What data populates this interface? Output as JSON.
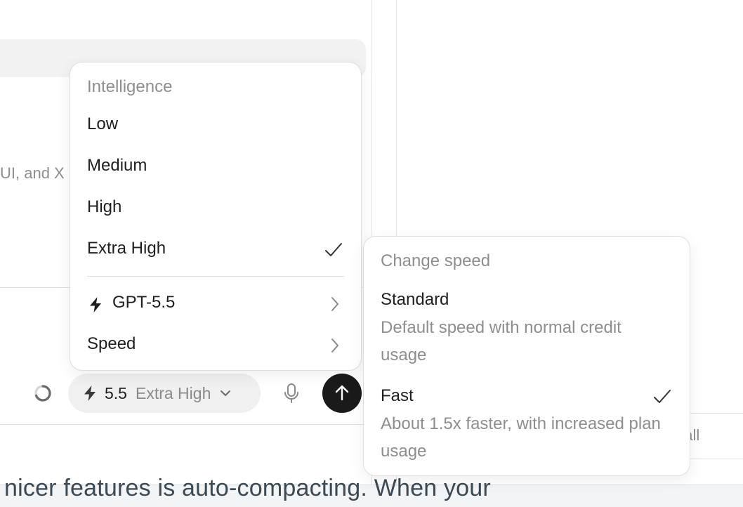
{
  "background": {
    "partial_text": "UI, and X",
    "right_card_text": "t all",
    "article_text": "nicer features is auto-compacting. When your"
  },
  "composer": {
    "model_version": "5.5",
    "model_effort": "Extra High",
    "icons": {
      "spinner": "spinner-icon",
      "bolt": "bolt-icon",
      "chevron": "chevron-down-icon",
      "mic": "mic-icon",
      "send": "arrow-up-icon"
    }
  },
  "intelligence_menu": {
    "heading": "Intelligence",
    "options": [
      {
        "label": "Low",
        "selected": false
      },
      {
        "label": "Medium",
        "selected": false
      },
      {
        "label": "High",
        "selected": false
      },
      {
        "label": "Extra High",
        "selected": true
      }
    ],
    "submenus": [
      {
        "label": "GPT-5.5",
        "icon": "bolt-icon"
      },
      {
        "label": "Speed"
      }
    ]
  },
  "speed_menu": {
    "heading": "Change speed",
    "options": [
      {
        "title": "Standard",
        "description": "Default speed with normal credit usage",
        "selected": false
      },
      {
        "title": "Fast",
        "description": "About 1.5x faster, with increased plan usage",
        "selected": true
      }
    ]
  },
  "colors": {
    "send_button": "#1a1a1a",
    "model_pill": "#f0f0f0",
    "muted_text": "#8e8e8e",
    "suggestion_pill": "#f1f2f1"
  }
}
